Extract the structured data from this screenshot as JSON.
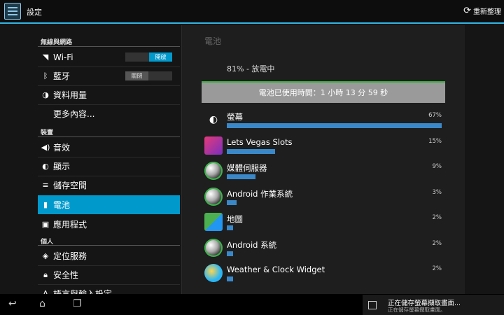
{
  "actionbar": {
    "title": "設定",
    "refresh_label": "重新整理",
    "accent": "#33b5e5"
  },
  "sidebar": {
    "section_wireless": "無線與網路",
    "wifi": {
      "label": "Wi-Fi",
      "toggle_on": "開啟"
    },
    "bluetooth": {
      "label": "藍牙",
      "toggle_off": "關閉"
    },
    "data_usage": "資料用量",
    "more": "更多內容...",
    "section_device": "裝置",
    "sound": "音效",
    "display": "顯示",
    "storage": "儲存空間",
    "battery": "電池",
    "apps": "應用程式",
    "section_personal": "個人",
    "location": "定位服務",
    "security": "安全性",
    "language": "語言與輸入設定"
  },
  "battery_panel": {
    "title": "電池",
    "status": "81% - 放電中",
    "graph_label": "電池已使用時間：1 小時 13 分 59 秒",
    "items": [
      {
        "name": "螢幕",
        "percent_label": "67%",
        "fraction": 0.67,
        "icon": "brightness-icon"
      },
      {
        "name": "Lets Vegas Slots",
        "percent_label": "15%",
        "fraction": 0.15,
        "icon": "slots-app-icon"
      },
      {
        "name": "媒體伺服器",
        "percent_label": "9%",
        "fraction": 0.09,
        "icon": "android-system-icon"
      },
      {
        "name": "Android 作業系統",
        "percent_label": "3%",
        "fraction": 0.03,
        "icon": "android-system-icon"
      },
      {
        "name": "地圖",
        "percent_label": "2%",
        "fraction": 0.02,
        "icon": "maps-icon"
      },
      {
        "name": "Android 系統",
        "percent_label": "2%",
        "fraction": 0.02,
        "icon": "android-system-icon"
      },
      {
        "name": "Weather & Clock Widget",
        "percent_label": "2%",
        "fraction": 0.02,
        "icon": "weather-icon"
      }
    ]
  },
  "notification": {
    "line1": "正在儲存螢幕擷取畫面...",
    "line2": "正在儲存螢幕擷取畫面。"
  }
}
